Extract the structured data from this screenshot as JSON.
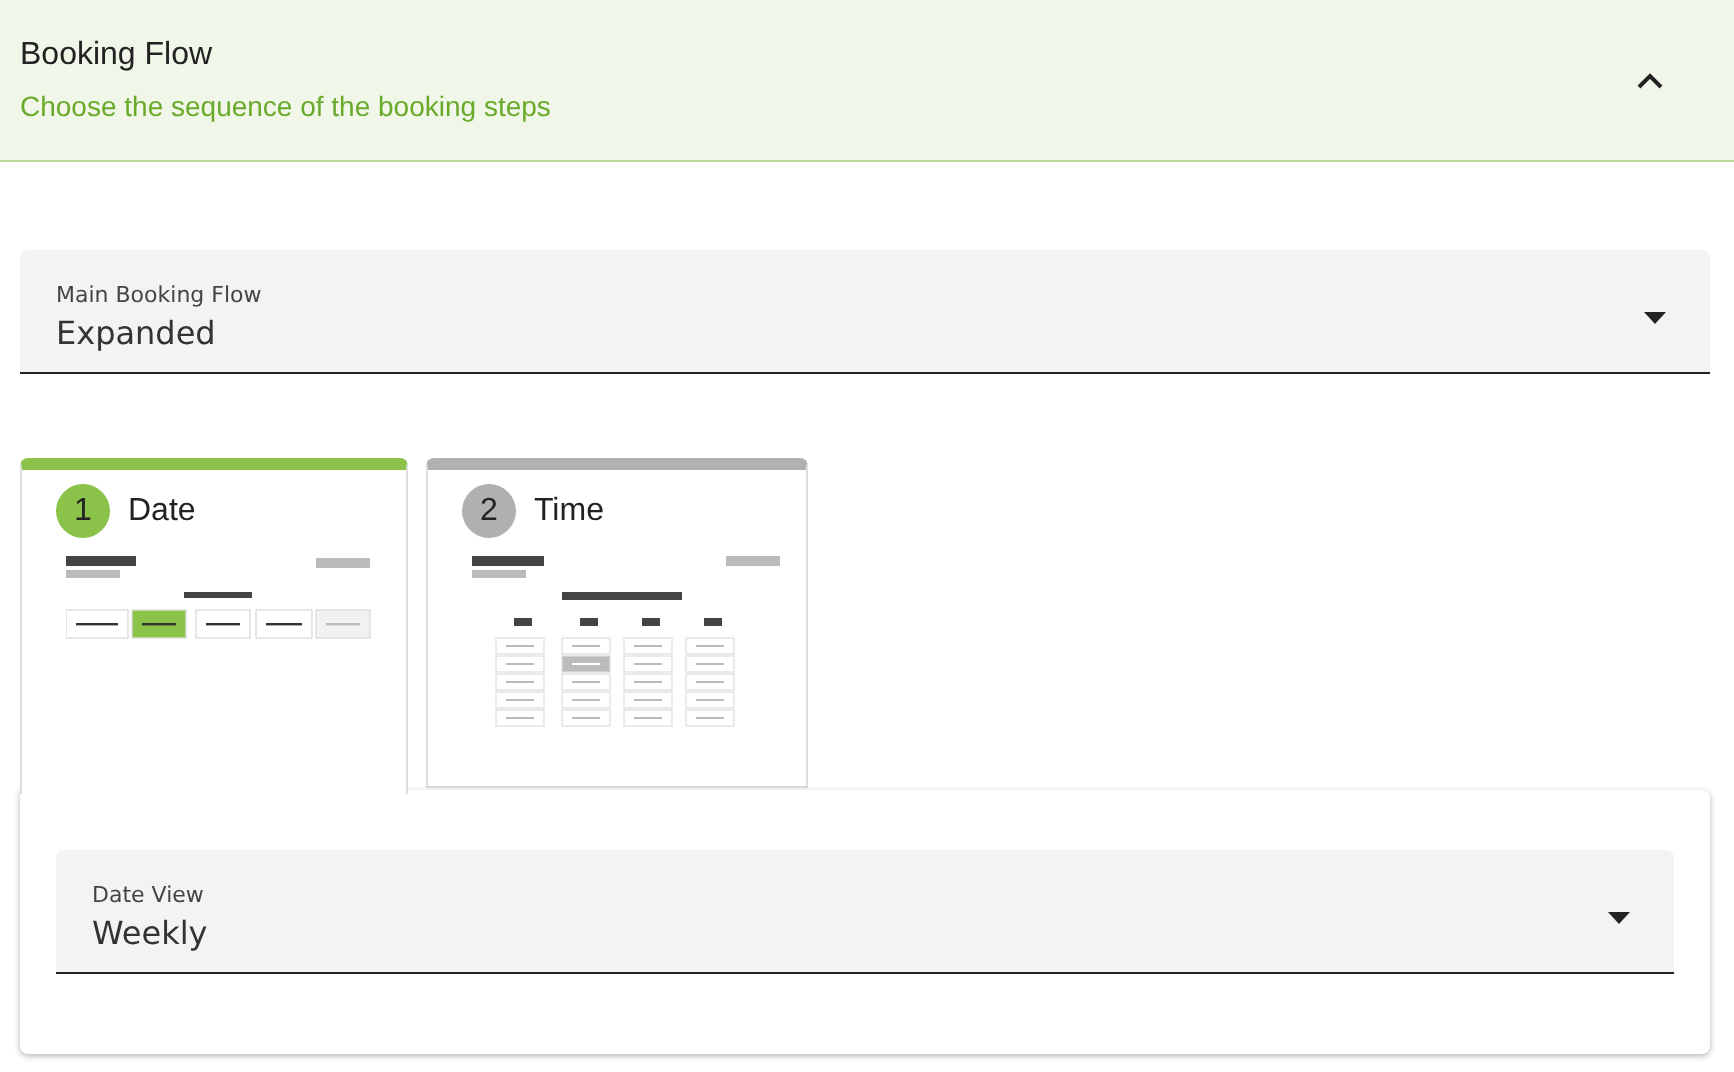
{
  "header": {
    "title": "Booking Flow",
    "subtitle": "Choose the sequence of the booking steps",
    "expanded": true
  },
  "main_flow": {
    "label": "Main Booking Flow",
    "value": "Expanded"
  },
  "steps": [
    {
      "number": "1",
      "label": "Date",
      "kind": "date",
      "selected": true
    },
    {
      "number": "2",
      "label": "Time",
      "kind": "time",
      "selected": false
    }
  ],
  "step_settings": {
    "label": "Date View",
    "value": "Weekly"
  }
}
